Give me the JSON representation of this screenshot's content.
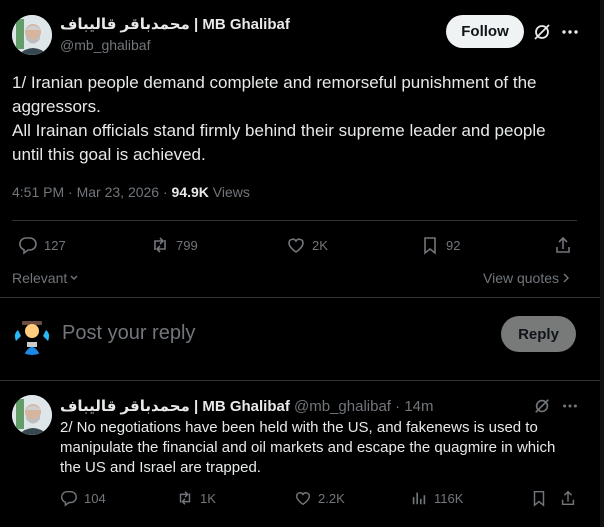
{
  "post": {
    "author_name": "محمدباقر قالیباف | MB Ghalibaf",
    "handle": "@mb_ghalibaf",
    "follow_label": "Follow",
    "text_line1": "1/ Iranian people demand complete and remorseful punishment of the",
    "text_line2": "aggressors.",
    "text_line3": "All Irainan officials stand firmly behind their supreme leader and people",
    "text_line4": "until this goal is achieved.",
    "time": "4:51 PM",
    "date": "Mar 23, 2026",
    "sep": "·",
    "views_count": "94.9K",
    "views_label": "Views",
    "replies": "127",
    "reposts": "799",
    "likes": "2K",
    "bookmarks": "92"
  },
  "sort": {
    "relevant_label": "Relevant",
    "view_quotes_label": "View quotes"
  },
  "composer": {
    "placeholder": "Post your reply",
    "reply_label": "Reply"
  },
  "reply": {
    "author_name": "محمدباقر قالیباف | MB Ghalibaf",
    "handle": "@mb_ghalibaf",
    "time": "14m",
    "text_line1": "2/ No negotiations have been held with the US, and fakenews is used to",
    "text_line2": "manipulate the financial and oil markets and escape the quagmire in which",
    "text_line3": "the US and Israel are trapped.",
    "replies": "104",
    "reposts": "1K",
    "likes": "2.2K",
    "views": "116K"
  },
  "colors": {
    "background": "#000000",
    "text": "#e7e9ea",
    "muted": "#71767b",
    "divider": "#2f3336"
  }
}
